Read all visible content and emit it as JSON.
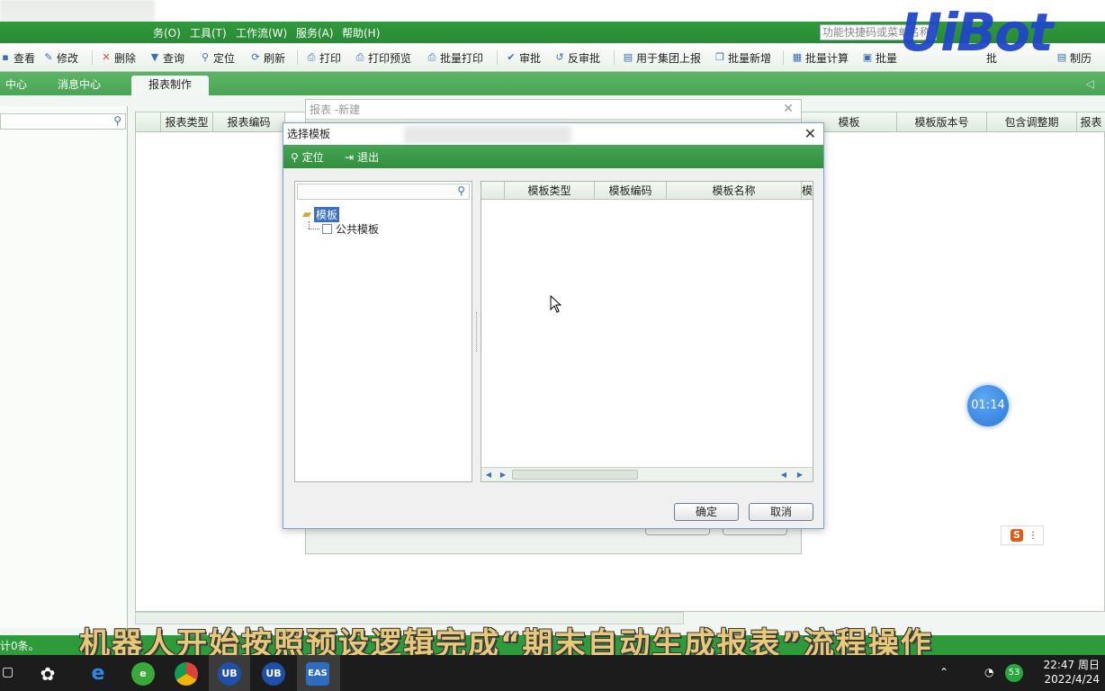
{
  "menubar": {
    "items": [
      "务(O)",
      "工具(T)",
      "工作流(W)",
      "服务(A)",
      "帮助(H)"
    ],
    "search_placeholder": "功能快捷码或菜单名称"
  },
  "toolbar": {
    "buttons": [
      "查看",
      "修改",
      "删除",
      "查询",
      "定位",
      "刷新",
      "打印",
      "打印预览",
      "批量打印",
      "审批",
      "反审批",
      "用于集团上报",
      "批量新增",
      "批量计算",
      "批量",
      "批",
      "制历"
    ]
  },
  "tabs": [
    "中心",
    "消息中心",
    "报表制作"
  ],
  "main_grid": {
    "columns": [
      "报表类型",
      "报表编码",
      "模板",
      "模板版本号",
      "包含调整期",
      "报表"
    ]
  },
  "background_dialog": {
    "title": "报表 -新建",
    "buttons": [
      "确定",
      "取消"
    ]
  },
  "dialog": {
    "title": "选择模板",
    "toolbar": [
      "定位",
      "退出"
    ],
    "tree": {
      "root": "模板",
      "children": [
        "公共模板"
      ]
    },
    "grid_columns": [
      "模板类型",
      "模板编码",
      "模板名称",
      "模"
    ],
    "ok_label": "确定",
    "cancel_label": "取消"
  },
  "statusbar": {
    "text": "计0条。"
  },
  "overlay": {
    "timer": "01:14",
    "logo": "UiBot",
    "caption": "机器人开始按照预设逻辑完成“期末自动生成报表”流程操作"
  },
  "taskbar": {
    "badge": "53",
    "time": "22:47 周日",
    "date": "2022/4/24"
  },
  "colors": {
    "brand_green": "#2e9b3a",
    "selection_blue": "#3b6fc2",
    "logo_blue": "#2147c9",
    "caption_gold": "#e8c97a"
  }
}
